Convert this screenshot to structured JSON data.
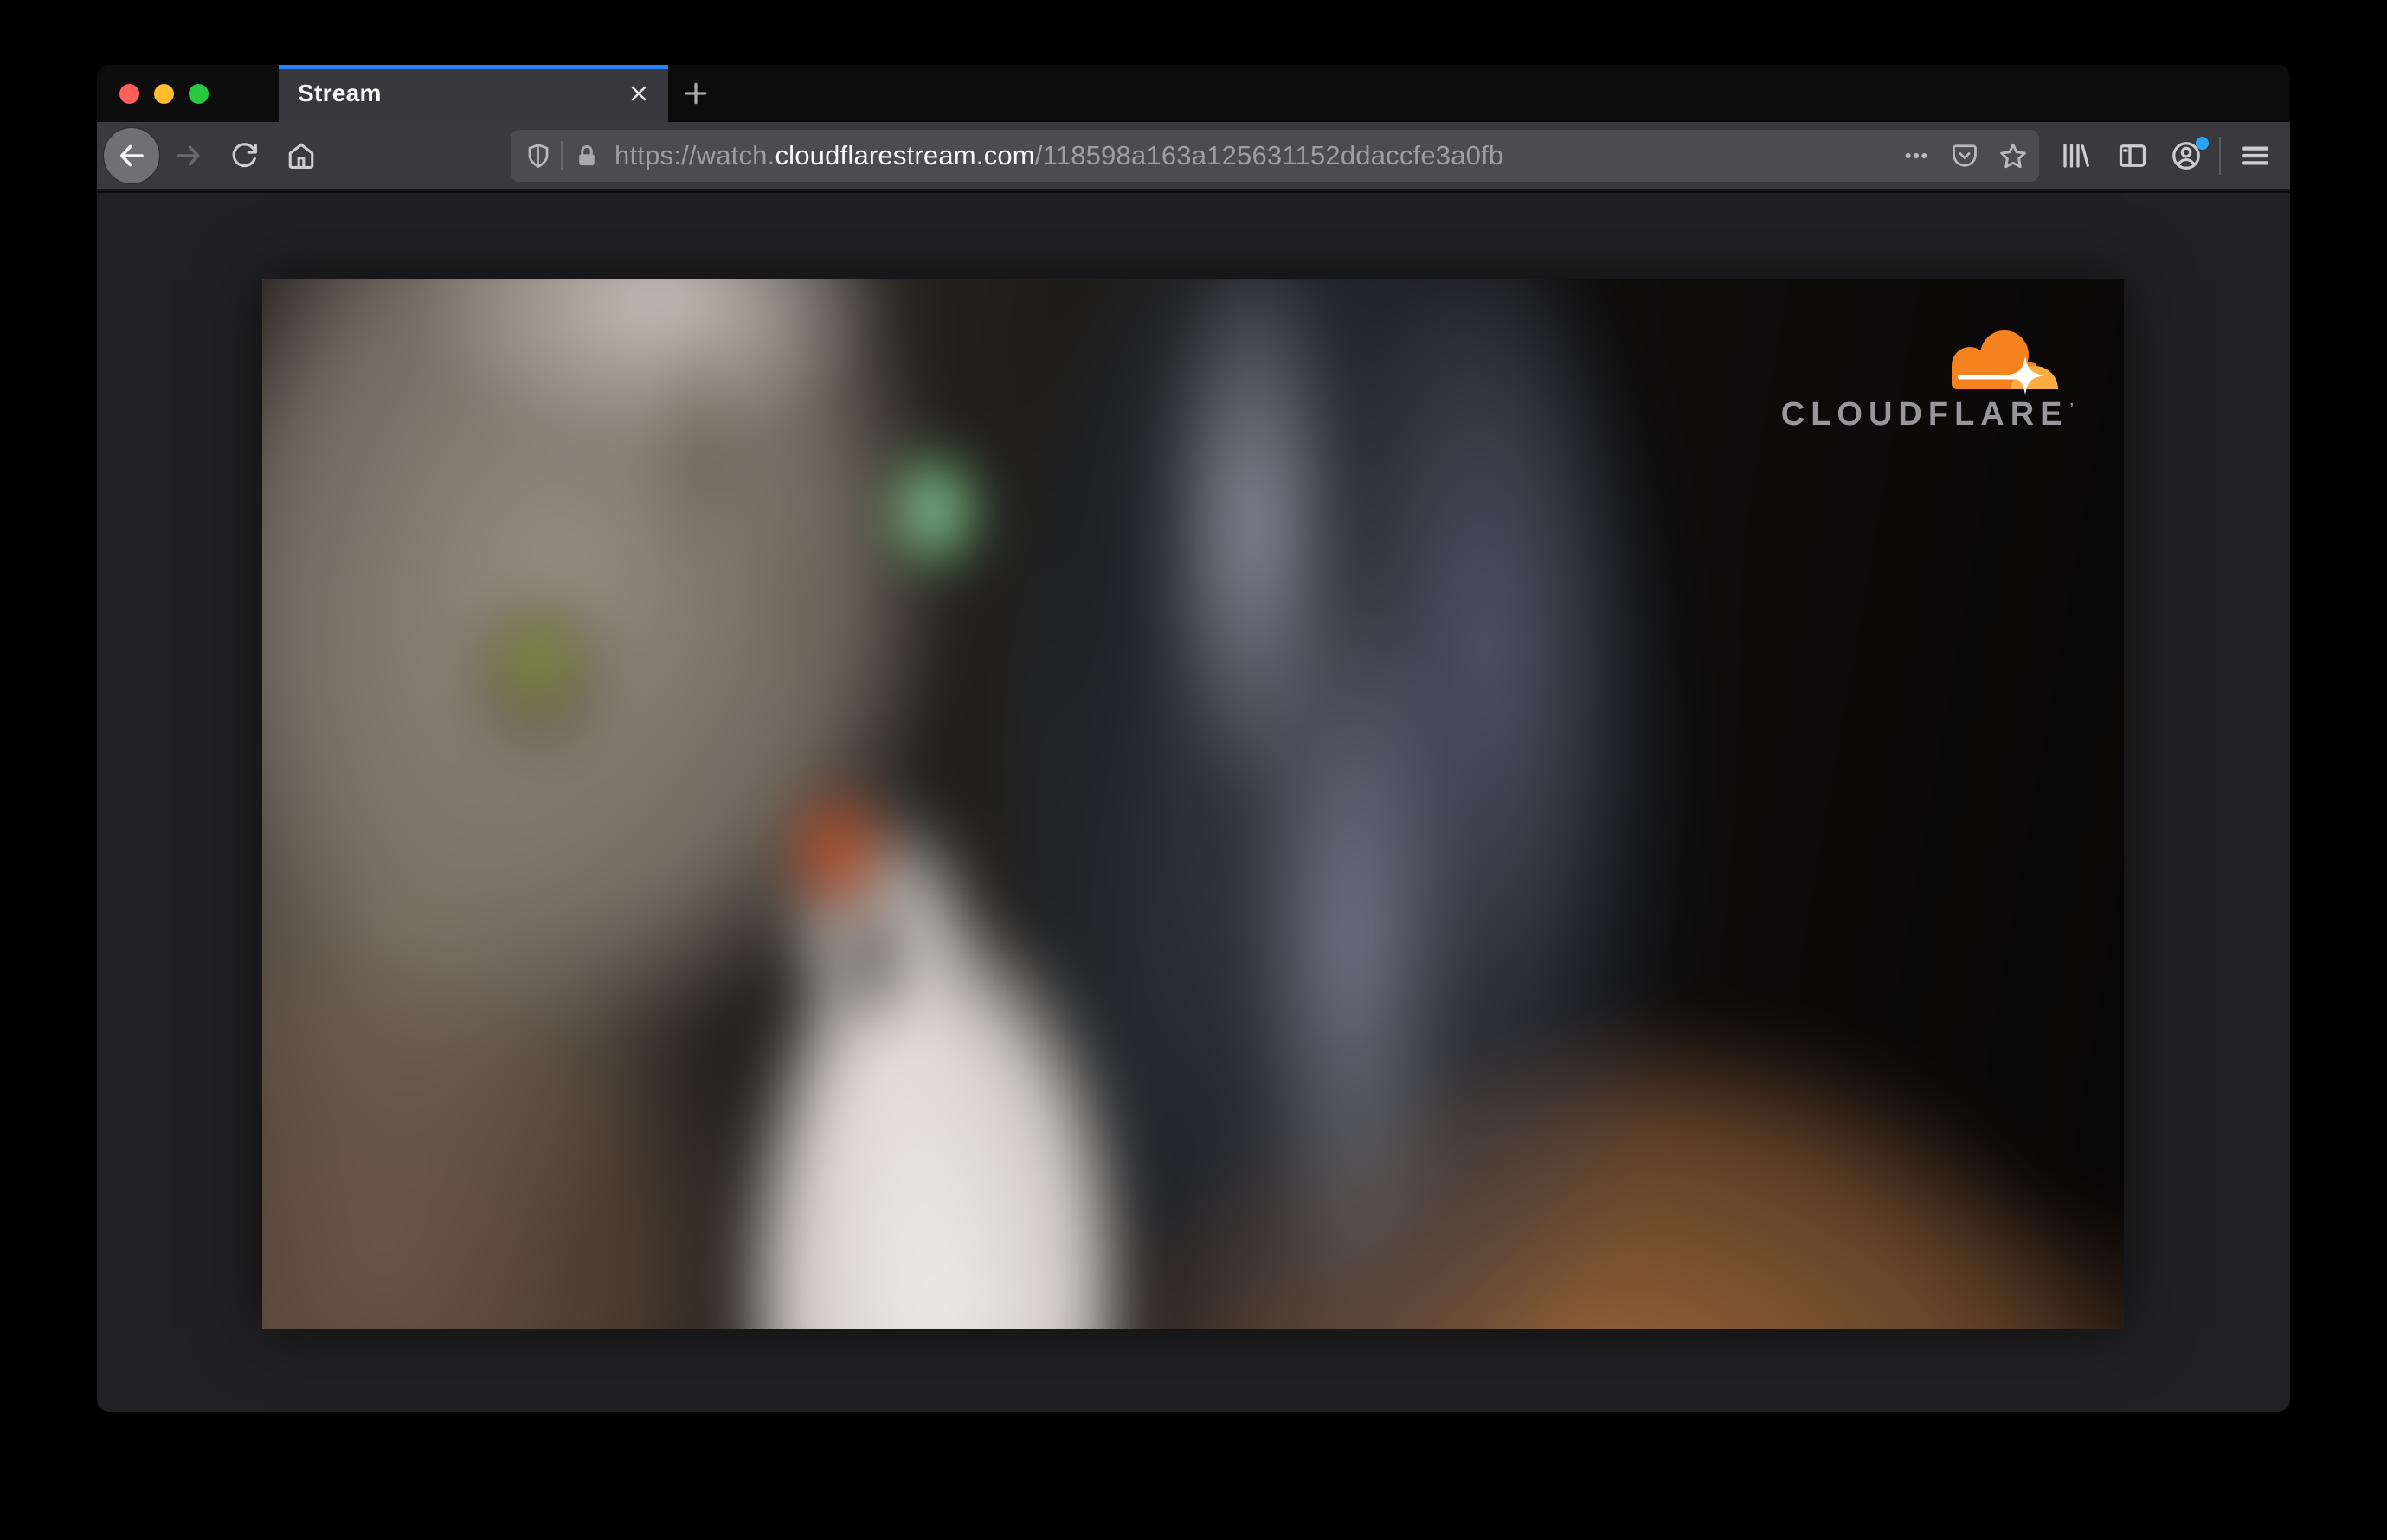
{
  "window": {
    "traffic_lights": [
      {
        "name": "close",
        "color": "#ff5f57"
      },
      {
        "name": "minimize",
        "color": "#febc2e"
      },
      {
        "name": "zoom",
        "color": "#2ac840"
      }
    ],
    "tab_bar": {
      "active_tab": {
        "title": "Stream",
        "accent_color": "#2e82f7"
      }
    },
    "toolbar": {
      "url_bar": {
        "scheme_subdomain": "https://watch.",
        "domain": "cloudflarestream.com",
        "path": "/118598a163a125631152ddaccfe3a0fb"
      },
      "account_badge_color": "#2aa3f8"
    }
  },
  "page": {
    "background_color": "#212123",
    "video_player": {
      "brand": {
        "logo_text": "CLOUDFLARE",
        "trademark": "’",
        "cloud_color": "#f6821f",
        "cloud_highlight_color": "#fbad41",
        "text_color": "#97979b"
      }
    }
  },
  "icons": [
    "back-icon",
    "forward-icon",
    "reload-icon",
    "home-icon",
    "shield-icon",
    "lock-icon",
    "ellipsis-icon",
    "pocket-icon",
    "bookmark-star-icon",
    "library-icon",
    "sidebar-icon",
    "account-icon",
    "menu-icon",
    "tab-close-icon",
    "new-tab-icon",
    "cloudflare-cloud-logo"
  ]
}
